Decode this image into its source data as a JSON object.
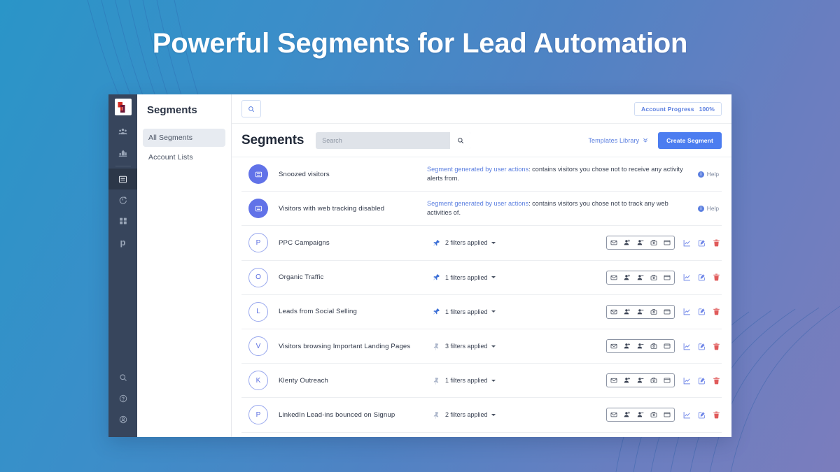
{
  "banner": {
    "title": "Powerful Segments for Lead Automation"
  },
  "theme": {
    "bg_gradient_from": "#2a95c8",
    "bg_gradient_to": "#7b7dbd",
    "rail_bg": "#37455c",
    "accent_blue": "#5b7fe0",
    "button_blue": "#4c7df0",
    "avatar_fill": "#6172e8",
    "trash_red": "#e05a5a"
  },
  "rail": {
    "logo_name": "app-logo",
    "items": [
      {
        "name": "audience-icon",
        "icon": "people"
      },
      {
        "name": "reports-icon",
        "icon": "bar-chart"
      },
      {
        "name": "segments-icon",
        "icon": "list",
        "active": true
      },
      {
        "name": "automation-icon",
        "icon": "timer"
      },
      {
        "name": "apps-icon",
        "icon": "grid"
      },
      {
        "name": "prospect-icon",
        "icon": "letter-p",
        "letter": "p"
      }
    ],
    "bottom_items": [
      {
        "name": "search-icon",
        "icon": "search"
      },
      {
        "name": "help-icon",
        "icon": "question-circle"
      },
      {
        "name": "account-icon",
        "icon": "user-circle"
      }
    ]
  },
  "subnav": {
    "title": "Segments",
    "items": [
      {
        "label": "All Segments",
        "selected": true
      },
      {
        "label": "Account Lists",
        "selected": false
      }
    ]
  },
  "topbar": {
    "search_button_icon": "search-icon",
    "account_progress_label": "Account Progress",
    "account_progress_value": "100%"
  },
  "page": {
    "title": "Segments",
    "search_placeholder": "Search",
    "search_value": "",
    "templates_link": "Templates Library",
    "create_button": "Create Segment"
  },
  "rows": [
    {
      "type": "system",
      "avatar": {
        "kind": "filled",
        "icon": "list-icon"
      },
      "name": "Snoozed visitors",
      "desc_link": "Segment generated by user actions",
      "desc_rest": ": contains visitors you chose not to receive any activity alerts from.",
      "help_label": "Help"
    },
    {
      "type": "system",
      "avatar": {
        "kind": "filled",
        "icon": "list-icon"
      },
      "name": "Visitors with web tracking disabled",
      "desc_link": "Segment generated by user actions",
      "desc_rest": ": contains visitors you chose not to track any web activities of.",
      "help_label": "Help"
    },
    {
      "type": "segment",
      "avatar": {
        "kind": "outline",
        "letter": "P"
      },
      "name": "PPC Campaigns",
      "pinned": true,
      "filters": "2 filters applied"
    },
    {
      "type": "segment",
      "avatar": {
        "kind": "outline",
        "letter": "O"
      },
      "name": "Organic Traffic",
      "pinned": true,
      "filters": "1 filters applied"
    },
    {
      "type": "segment",
      "avatar": {
        "kind": "outline",
        "letter": "L"
      },
      "name": "Leads from Social Selling",
      "pinned": true,
      "filters": "1 filters applied"
    },
    {
      "type": "segment",
      "avatar": {
        "kind": "outline",
        "letter": "V"
      },
      "name": "Visitors browsing Important Landing Pages",
      "pinned": false,
      "filters": "3 filters applied"
    },
    {
      "type": "segment",
      "avatar": {
        "kind": "outline",
        "letter": "K"
      },
      "name": "Klenty Outreach",
      "pinned": false,
      "filters": "1 filters applied"
    },
    {
      "type": "segment",
      "avatar": {
        "kind": "outline",
        "letter": "P"
      },
      "name": "LinkedIn Lead-ins bounced on Signup",
      "pinned": false,
      "filters": "2 filters applied"
    }
  ],
  "row_actions": {
    "group": [
      {
        "name": "email-icon"
      },
      {
        "name": "add-person-icon"
      },
      {
        "name": "remove-person-icon"
      },
      {
        "name": "briefcase-icon"
      },
      {
        "name": "window-icon"
      }
    ],
    "extra": [
      {
        "name": "analytics-icon"
      },
      {
        "name": "edit-icon"
      },
      {
        "name": "delete-icon"
      }
    ]
  }
}
